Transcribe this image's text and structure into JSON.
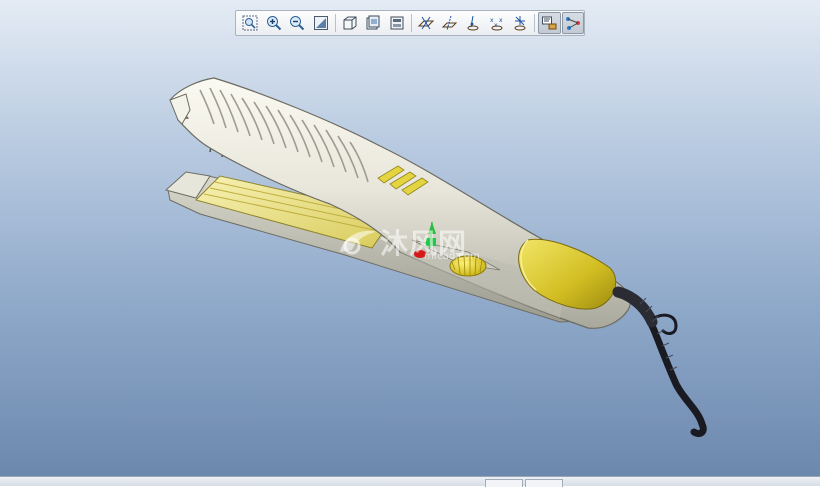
{
  "app": {
    "window": "3D model viewer"
  },
  "toolbar": {
    "buttons": [
      {
        "id": "zoom-window",
        "icon": "zoom-window-icon"
      },
      {
        "id": "zoom-in",
        "icon": "zoom-in-icon"
      },
      {
        "id": "zoom-out",
        "icon": "zoom-out-icon"
      },
      {
        "id": "refit",
        "icon": "refit-icon"
      },
      {
        "id": "display-style",
        "icon": "display-style-icon"
      },
      {
        "id": "saved-views",
        "icon": "saved-views-icon"
      },
      {
        "id": "view-manager",
        "icon": "view-manager-icon"
      },
      {
        "id": "datum-planes",
        "icon": "datum-planes-icon"
      },
      {
        "id": "datum-axes",
        "icon": "datum-axes-icon"
      },
      {
        "id": "datum-points",
        "icon": "datum-points-icon"
      },
      {
        "id": "coordinate-systems",
        "icon": "coordinate-systems-icon"
      },
      {
        "id": "spin-center",
        "icon": "spin-center-icon"
      },
      {
        "id": "annotations",
        "icon": "annotations-icon",
        "active": true
      },
      {
        "id": "model-tree",
        "icon": "model-tree-icon",
        "active": true
      }
    ]
  },
  "watermark": {
    "text": "沐风网",
    "sub": "mfcad.com"
  },
  "colors": {
    "body": "#e6e4d8",
    "accent_yellow": "#e3d440",
    "plate": "#efe69a",
    "cord": "#1a1a22",
    "background_top": "#e4ebf4",
    "background_bottom": "#6c88ad"
  }
}
